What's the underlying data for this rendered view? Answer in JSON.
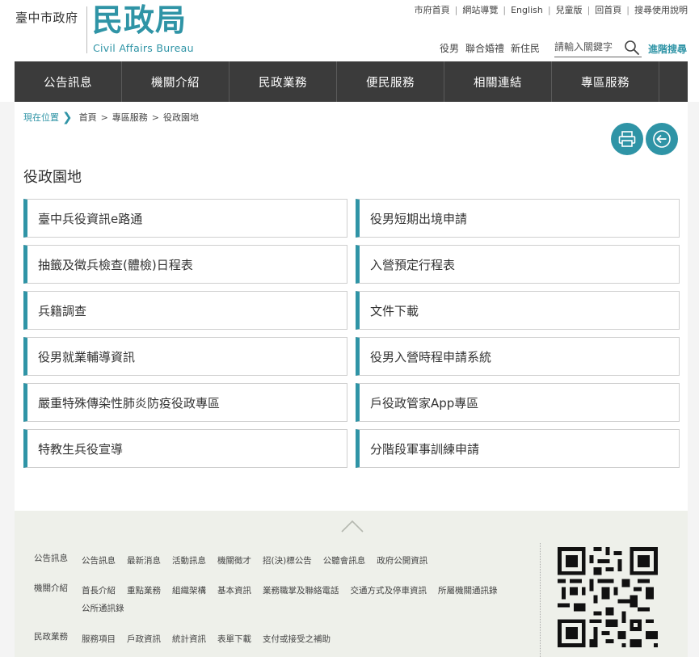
{
  "header": {
    "gov_name": "臺中市政府",
    "logo_title": "民政局",
    "logo_subtitle": "Civil Affairs Bureau",
    "top_links": [
      "市府首頁",
      "網站導覽",
      "English",
      "兒童版",
      "回首頁",
      "搜尋使用說明"
    ],
    "quick_links": [
      "役男",
      "聯合婚禮",
      "新住民"
    ],
    "search_placeholder": "請輸入關鍵字",
    "advanced_search": "進階搜尋"
  },
  "nav": {
    "items": [
      "公告訊息",
      "機關介紹",
      "民政業務",
      "便民服務",
      "相關連結",
      "專區服務"
    ]
  },
  "breadcrumb": {
    "label": "現在位置",
    "chevron": "❯",
    "items": [
      "首頁",
      "專區服務",
      "役政園地"
    ],
    "sep": ">"
  },
  "page": {
    "title": "役政園地"
  },
  "cards": {
    "left": [
      "臺中兵役資訊e路通",
      "抽籤及徵兵檢查(體檢)日程表",
      "兵籍調查",
      "役男就業輔導資訊",
      "嚴重特殊傳染性肺炎防疫役政專區",
      "特教生兵役宣導"
    ],
    "right": [
      "役男短期出境申請",
      "入營預定行程表",
      "文件下載",
      "役男入營時程申請系統",
      "戶役政管家App專區",
      "分階段軍事訓練申請"
    ]
  },
  "footer": {
    "rows": [
      {
        "head": "公告訊息",
        "links": [
          "公告訊息",
          "最新消息",
          "活動訊息",
          "機關徵才",
          "招(決)標公告",
          "公聽會訊息",
          "政府公開資訊"
        ]
      },
      {
        "head": "機關介紹",
        "links": [
          "首長介紹",
          "重點業務",
          "組織架構",
          "基本資訊",
          "業務職掌及聯絡電話",
          "交通方式及停車資訊",
          "所屬機關通訊錄",
          "公所通訊錄"
        ]
      },
      {
        "head": "民政業務",
        "links": [
          "服務項目",
          "戶政資訊",
          "統計資訊",
          "表單下載",
          "支付或接受之補助"
        ]
      }
    ]
  },
  "colors": {
    "accent": "#2f94a6",
    "nav_bg": "#3b3b3b",
    "footer_bg": "#eef0ea"
  },
  "icons": [
    "search-icon",
    "print-icon",
    "back-arrow-icon",
    "chevron-up-icon",
    "qr-code-icon"
  ]
}
